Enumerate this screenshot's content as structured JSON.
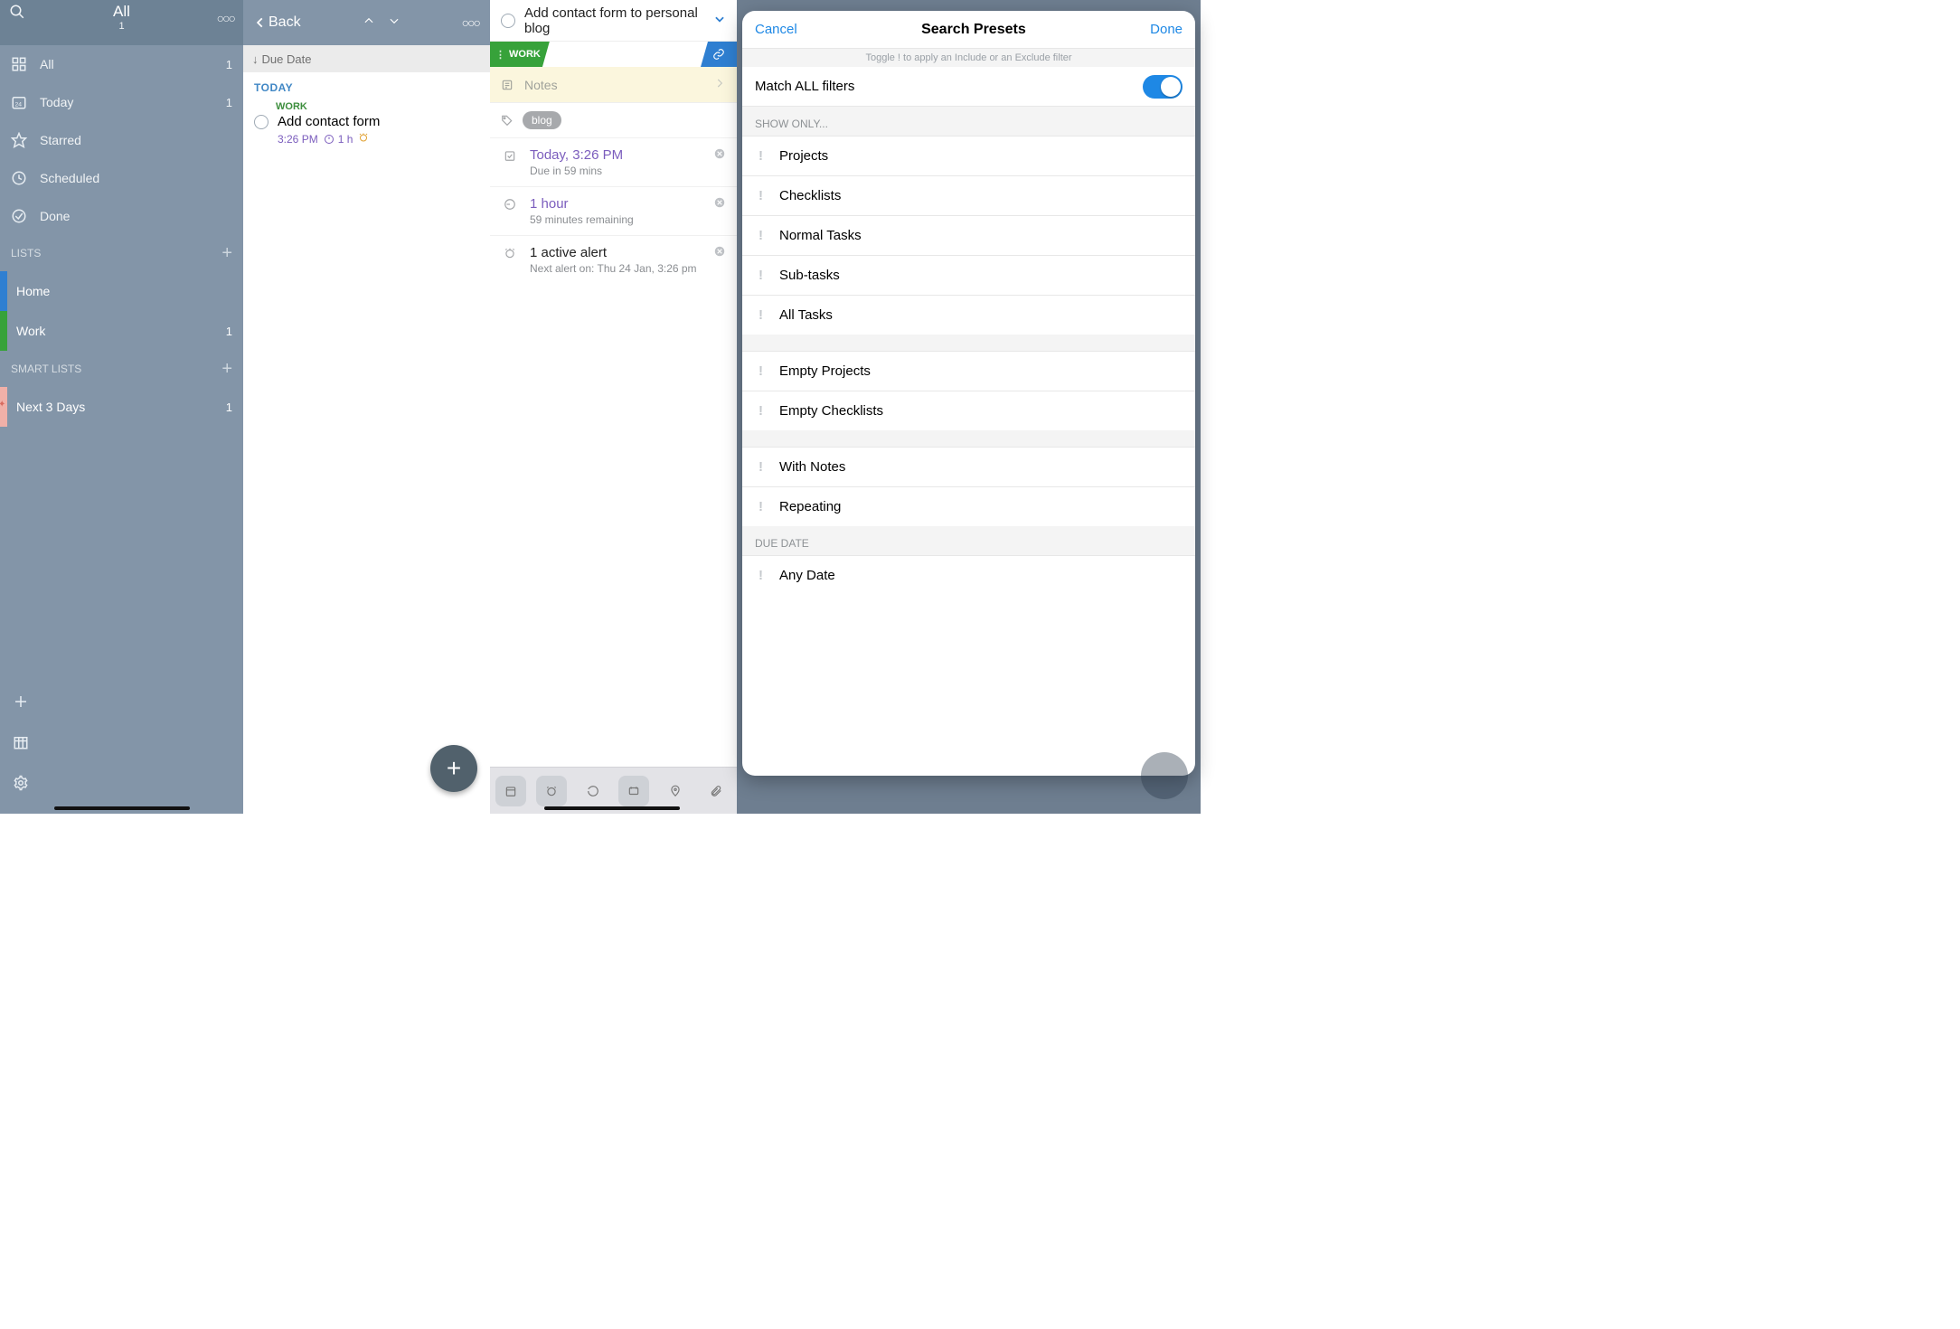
{
  "panel1": {
    "title": "All",
    "subtitle": "1",
    "smart": {
      "all": {
        "label": "All",
        "count": "1"
      },
      "today": {
        "label": "Today",
        "count": "1"
      },
      "starred": {
        "label": "Starred",
        "count": ""
      },
      "scheduled": {
        "label": "Scheduled",
        "count": ""
      },
      "done": {
        "label": "Done",
        "count": ""
      }
    },
    "lists_header": "LISTS",
    "lists": [
      {
        "label": "Home",
        "count": "",
        "color": "#2f7fd1"
      },
      {
        "label": "Work",
        "count": "1",
        "color": "#37a23a"
      }
    ],
    "smartlists_header": "SMART LISTS",
    "smartlists": [
      {
        "label": "Next 3 Days",
        "count": "1"
      }
    ]
  },
  "panel2": {
    "back": "Back",
    "sortbar": "Due Date",
    "section": "TODAY",
    "task": {
      "tag": "WORK",
      "title": "Add contact form",
      "time": "3:26 PM",
      "duration": "1 h"
    }
  },
  "panel3": {
    "title": "Add contact form to personal blog",
    "work_badge": "WORK",
    "notes_placeholder": "Notes",
    "tags": [
      "blog"
    ],
    "due": {
      "primary": "Today, 3:26 PM",
      "secondary": "Due in 59 mins"
    },
    "duration": {
      "primary": "1 hour",
      "secondary": "59 minutes remaining"
    },
    "alert": {
      "primary": "1 active alert",
      "secondary": "Next alert on: Thu 24 Jan, 3:26 pm"
    }
  },
  "panel4": {
    "cancel": "Cancel",
    "done": "Done",
    "title": "Search Presets",
    "subtitle": "Toggle ! to apply an Include or an Exclude filter",
    "match_all": "Match ALL filters",
    "show_only": "SHOW ONLY...",
    "group1": [
      "Projects",
      "Checklists",
      "Normal Tasks",
      "Sub-tasks",
      "All Tasks"
    ],
    "group2": [
      "Empty Projects",
      "Empty Checklists"
    ],
    "group3": [
      "With Notes",
      "Repeating"
    ],
    "due_date_header": "DUE DATE",
    "group4": [
      "Any Date"
    ]
  }
}
